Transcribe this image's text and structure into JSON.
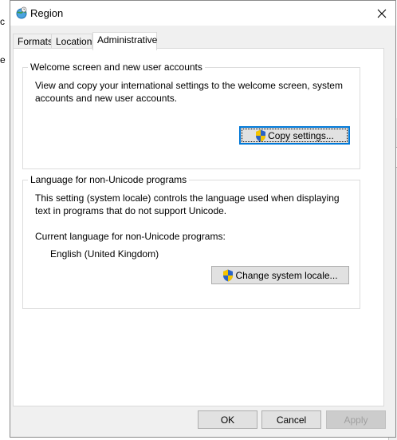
{
  "window": {
    "title": "Region"
  },
  "tabs": [
    {
      "label": "Formats"
    },
    {
      "label": "Location"
    },
    {
      "label": "Administrative"
    }
  ],
  "welcome_group": {
    "title": "Welcome screen and new user accounts",
    "description_line1": "View and copy your international settings to the welcome screen, system",
    "description_line2": "accounts and new user accounts.",
    "copy_button": "Copy settings..."
  },
  "unicode_group": {
    "title": "Language for non-Unicode programs",
    "description_line1": "This setting (system locale) controls the language used when displaying",
    "description_line2": "text in programs that do not support Unicode.",
    "current_label": "Current language for non-Unicode programs:",
    "current_value": "English (United Kingdom)",
    "change_button": "Change system locale..."
  },
  "footer": {
    "ok": "OK",
    "cancel": "Cancel",
    "apply": "Apply"
  },
  "background": {
    "frag_left_1": "c",
    "frag_left_2": "e",
    "frag_right": "o"
  }
}
